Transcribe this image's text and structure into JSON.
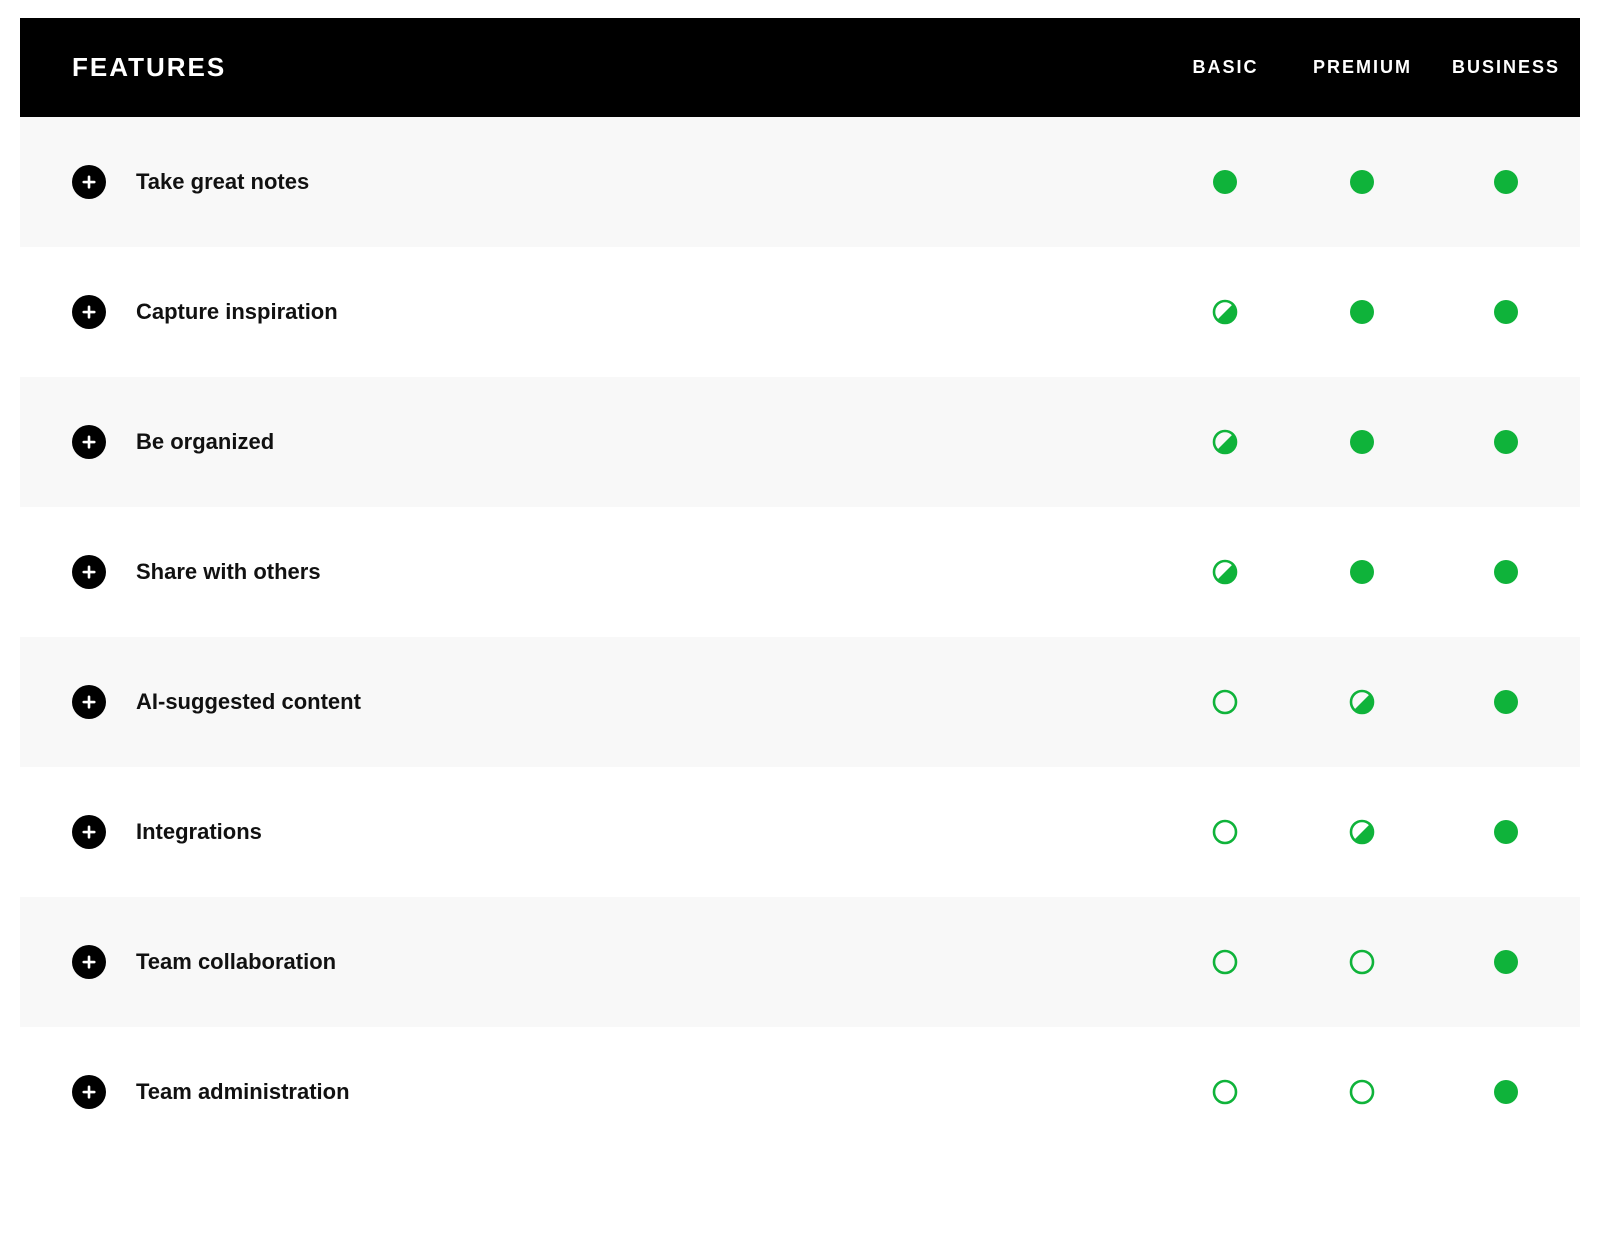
{
  "colors": {
    "green": "#0fb33a",
    "black": "#000000"
  },
  "header": {
    "features_label": "FEATURES",
    "plans": [
      "BASIC",
      "PREMIUM",
      "BUSINESS"
    ]
  },
  "rows": [
    {
      "label": "Take great notes",
      "status": [
        "full",
        "full",
        "full"
      ]
    },
    {
      "label": "Capture inspiration",
      "status": [
        "partial",
        "full",
        "full"
      ]
    },
    {
      "label": "Be organized",
      "status": [
        "partial",
        "full",
        "full"
      ]
    },
    {
      "label": "Share with others",
      "status": [
        "partial",
        "full",
        "full"
      ]
    },
    {
      "label": "AI-suggested content",
      "status": [
        "empty",
        "partial",
        "full"
      ]
    },
    {
      "label": "Integrations",
      "status": [
        "empty",
        "partial",
        "full"
      ]
    },
    {
      "label": "Team collaboration",
      "status": [
        "empty",
        "empty",
        "full"
      ]
    },
    {
      "label": "Team administration",
      "status": [
        "empty",
        "empty",
        "full"
      ]
    }
  ]
}
